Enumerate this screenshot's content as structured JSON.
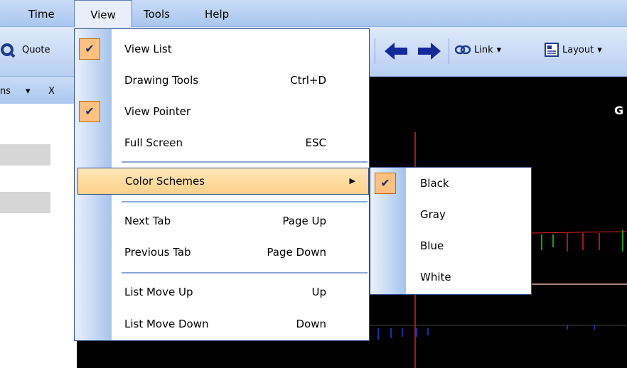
{
  "menubar": {
    "items": [
      {
        "label": "Time"
      },
      {
        "label": "View"
      },
      {
        "label": "Tools"
      },
      {
        "label": "Help"
      }
    ]
  },
  "toolbar": {
    "quote_label": "Quote",
    "link_label": "Link",
    "layout_label": "Layout"
  },
  "panel": {
    "header_label": "ns",
    "close_label": "X"
  },
  "chart": {
    "title_fragment": "G"
  },
  "view_menu": {
    "items": [
      {
        "label": "View List",
        "shortcut": "",
        "checked": true
      },
      {
        "label": "Drawing Tools",
        "shortcut": "Ctrl+D",
        "checked": false
      },
      {
        "label": "View Pointer",
        "shortcut": "",
        "checked": true
      },
      {
        "label": "Full Screen",
        "shortcut": "ESC",
        "checked": false
      },
      {
        "label": "Color Schemes",
        "shortcut": "",
        "checked": false
      },
      {
        "label": "Next Tab",
        "shortcut": "Page Up",
        "checked": false
      },
      {
        "label": "Previous Tab",
        "shortcut": "Page Down",
        "checked": false
      },
      {
        "label": "List Move Up",
        "shortcut": "Up",
        "checked": false
      },
      {
        "label": "List Move Down",
        "shortcut": "Down",
        "checked": false
      }
    ]
  },
  "color_schemes_menu": {
    "items": [
      {
        "label": "Black",
        "checked": true
      },
      {
        "label": "Gray",
        "checked": false
      },
      {
        "label": "Blue",
        "checked": false
      },
      {
        "label": "White",
        "checked": false
      }
    ]
  },
  "icons": {
    "check": "✔",
    "submenu_arrow": "▶",
    "dropdown": "▾"
  },
  "colors": {
    "highlight": "#ffd18a",
    "check_bg": "#ffc080",
    "chart_bg": "#000000",
    "menu_border": "#2f4f86"
  }
}
